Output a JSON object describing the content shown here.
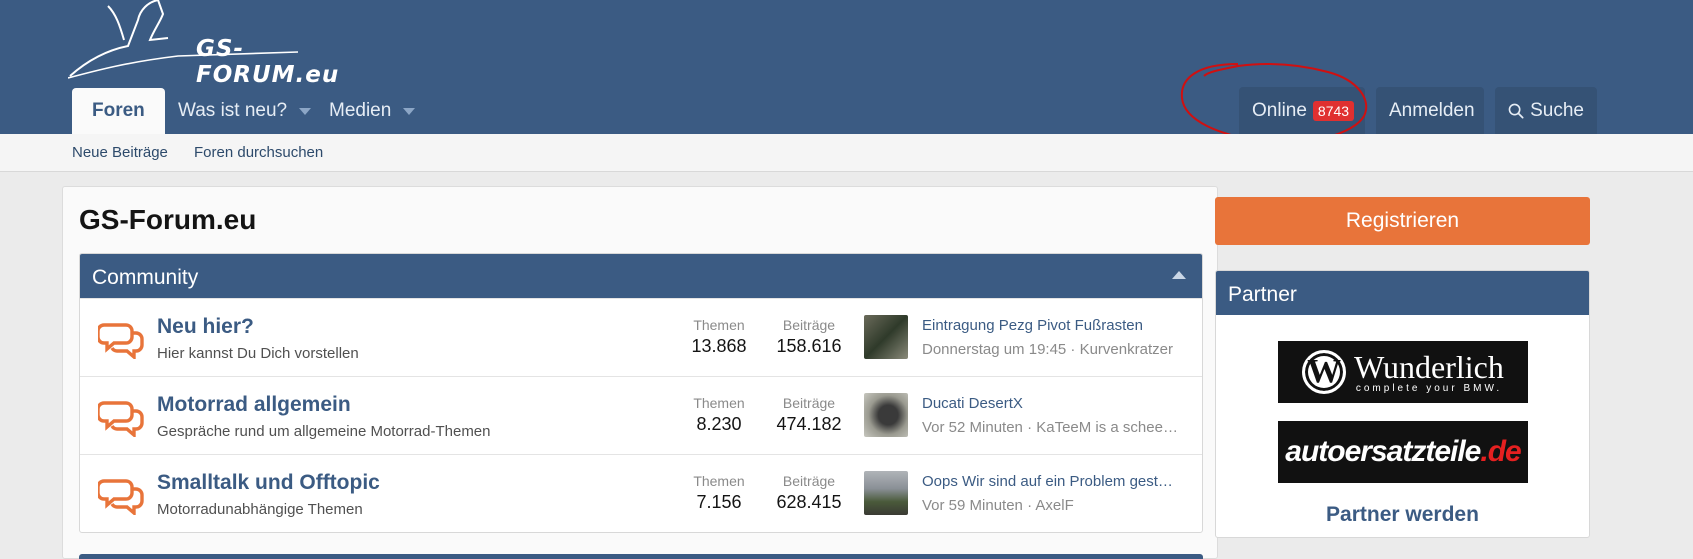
{
  "logo": {
    "text": "GS-FORUM.eu"
  },
  "nav": {
    "tabs": [
      {
        "label": "Foren",
        "active": true
      },
      {
        "label": "Was ist neu?",
        "has_dropdown": true
      },
      {
        "label": "Medien",
        "has_dropdown": true
      }
    ],
    "online_label": "Online",
    "online_count": "8743",
    "login_label": "Anmelden",
    "search_label": "Suche"
  },
  "subnav": {
    "links": [
      "Neue Beiträge",
      "Foren durchsuchen"
    ]
  },
  "page_title": "GS-Forum.eu",
  "community": {
    "header": "Community",
    "forums": [
      {
        "name": "Neu hier?",
        "description": "Hier kannst Du Dich vorstellen",
        "themen_label": "Themen",
        "themen": "13.868",
        "beitraege_label": "Beiträge",
        "beitraege": "158.616",
        "latest_title": "Eintragung Pezg Pivot Fußrasten",
        "latest_meta": "Donnerstag um 19:45 · Kurvenkratzer"
      },
      {
        "name": "Motorrad allgemein",
        "description": "Gespräche rund um allgemeine Motorrad-Themen",
        "themen_label": "Themen",
        "themen": "8.230",
        "beitraege_label": "Beiträge",
        "beitraege": "474.182",
        "latest_title": "Ducati DesertX",
        "latest_meta": "Vor 52 Minuten · KaTeeM is a schee…"
      },
      {
        "name": "Smalltalk und Offtopic",
        "description": "Motorradunabhängige Themen",
        "themen_label": "Themen",
        "themen": "7.156",
        "beitraege_label": "Beiträge",
        "beitraege": "628.415",
        "latest_title": "Oops Wir sind auf ein Problem gest…",
        "latest_meta": "Vor 59 Minuten · AxelF"
      }
    ]
  },
  "sidebar": {
    "register_label": "Registrieren",
    "partner_header": "Partner",
    "ad1_name": "Wunderlich",
    "ad1_sub": "complete your BMW.",
    "ad1_letter": "W",
    "ad2_name": "autoersatzteile",
    "ad2_tld": ".de",
    "partner_link": "Partner werden"
  },
  "colors": {
    "header_bg": "#3b5b83",
    "accent_orange": "#e8743a",
    "badge_red": "#e03030",
    "annotation_red": "#d01010"
  }
}
